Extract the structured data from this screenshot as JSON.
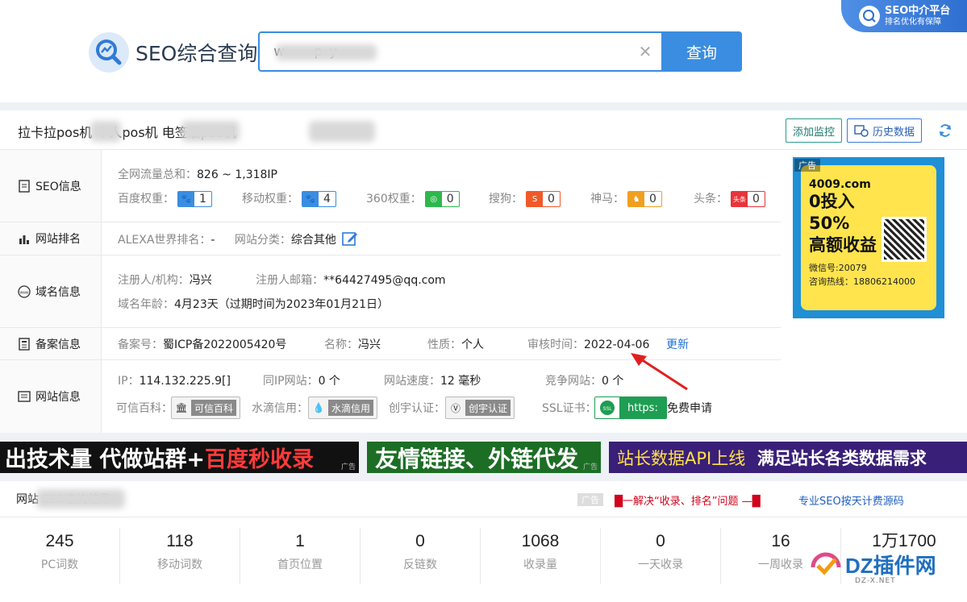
{
  "header": {
    "logo_text": "SEO综合查询",
    "search_value": "w        p  y",
    "search_button": "查询",
    "badge_line1": "SEO中介平台",
    "badge_line2": "排名优化有保障"
  },
  "title_bar": {
    "site_title": "拉卡拉pos机        个人pos机              电签版pos机",
    "add_monitor": "添加监控",
    "history": "历史数据"
  },
  "seo_info": {
    "label": "SEO信息",
    "traffic_key": "全网流量总和：",
    "traffic_value": "826 ~ 1,318IP",
    "baidu_key": "百度权重：",
    "baidu_value": "1",
    "mobile_key": "移动权重：",
    "mobile_value": "4",
    "s360_key": "360权重：",
    "s360_value": "0",
    "sogou_key": "搜狗：",
    "sogou_value": "0",
    "shenma_key": "神马：",
    "shenma_value": "0",
    "toutiao_key": "头条：",
    "toutiao_value": "0"
  },
  "rank_info": {
    "label": "网站排名",
    "alexa_key": "ALEXA世界排名：",
    "alexa_value": "-",
    "category_key": "网站分类：",
    "category_value": "综合其他"
  },
  "domain_info": {
    "label": "域名信息",
    "registrant_key": "注册人/机构：",
    "registrant_value": "冯兴",
    "email_key": "注册人邮箱：",
    "email_value": "**64427495@qq.com",
    "age_key": "域名年龄：",
    "age_value": "4月23天（过期时间为2023年01月21日）"
  },
  "icp_info": {
    "label": "备案信息",
    "icp_key": "备案号：",
    "icp_value": "蜀ICP备2022005420号",
    "name_key": "名称：",
    "name_value": "冯兴",
    "nature_key": "性质：",
    "nature_value": "个人",
    "audit_key": "审核时间：",
    "audit_value": "2022-04-06",
    "update_link": "更新"
  },
  "site_info": {
    "label": "网站信息",
    "ip_key": "IP：",
    "ip_value": "114.132.225.9[]",
    "same_ip_key": "同IP网站：",
    "same_ip_value": "0 个",
    "speed_key": "网站速度：",
    "speed_value": "12 毫秒",
    "compete_key": "竞争网站：",
    "compete_value": "0 个",
    "baike_key": "可信百科：",
    "baike_badge": "可信百科",
    "shuidi_key": "水滴信用：",
    "shuidi_badge": "水滴信用",
    "chuangyu_key": "创宇认证：",
    "chuangyu_badge": "创宇认证",
    "ssl_key": "SSL证书：",
    "ssl_badge": "https:",
    "ssl_free": "免费申请"
  },
  "side_ad": {
    "tag": "广告",
    "site": "4009.com",
    "line1": "0投入",
    "line2": "50%",
    "line3": "高额收益",
    "wechat": "微信号:20079",
    "hotline": "咨询热线：18806214000"
  },
  "banners": {
    "b1_white": "出技术量 代做站群+",
    "b1_red": "百度秒收录",
    "b2": "友情链接、外链代发",
    "b3_thin": "站长数据API上线",
    "b3_bold": "满足站长各类数据需求",
    "ad_tag": "广告"
  },
  "results": {
    "title": "网站                    SEO查询结果",
    "ad_tag": "广告",
    "promo1": "█一解决“收录、排名”问题 —█",
    "promo2": "专业SEO按天计费源码",
    "stats": [
      {
        "value": "245",
        "label": "PC词数"
      },
      {
        "value": "118",
        "label": "移动词数"
      },
      {
        "value": "1",
        "label": "首页位置"
      },
      {
        "value": "0",
        "label": "反链数"
      },
      {
        "value": "1068",
        "label": "收录量"
      },
      {
        "value": "0",
        "label": "一天收录"
      },
      {
        "value": "16",
        "label": "一周收录"
      },
      {
        "value": "1万1700",
        "label": ""
      }
    ]
  },
  "watermark": {
    "text": "DZ插件网",
    "sub": "DZ-X.NET"
  }
}
